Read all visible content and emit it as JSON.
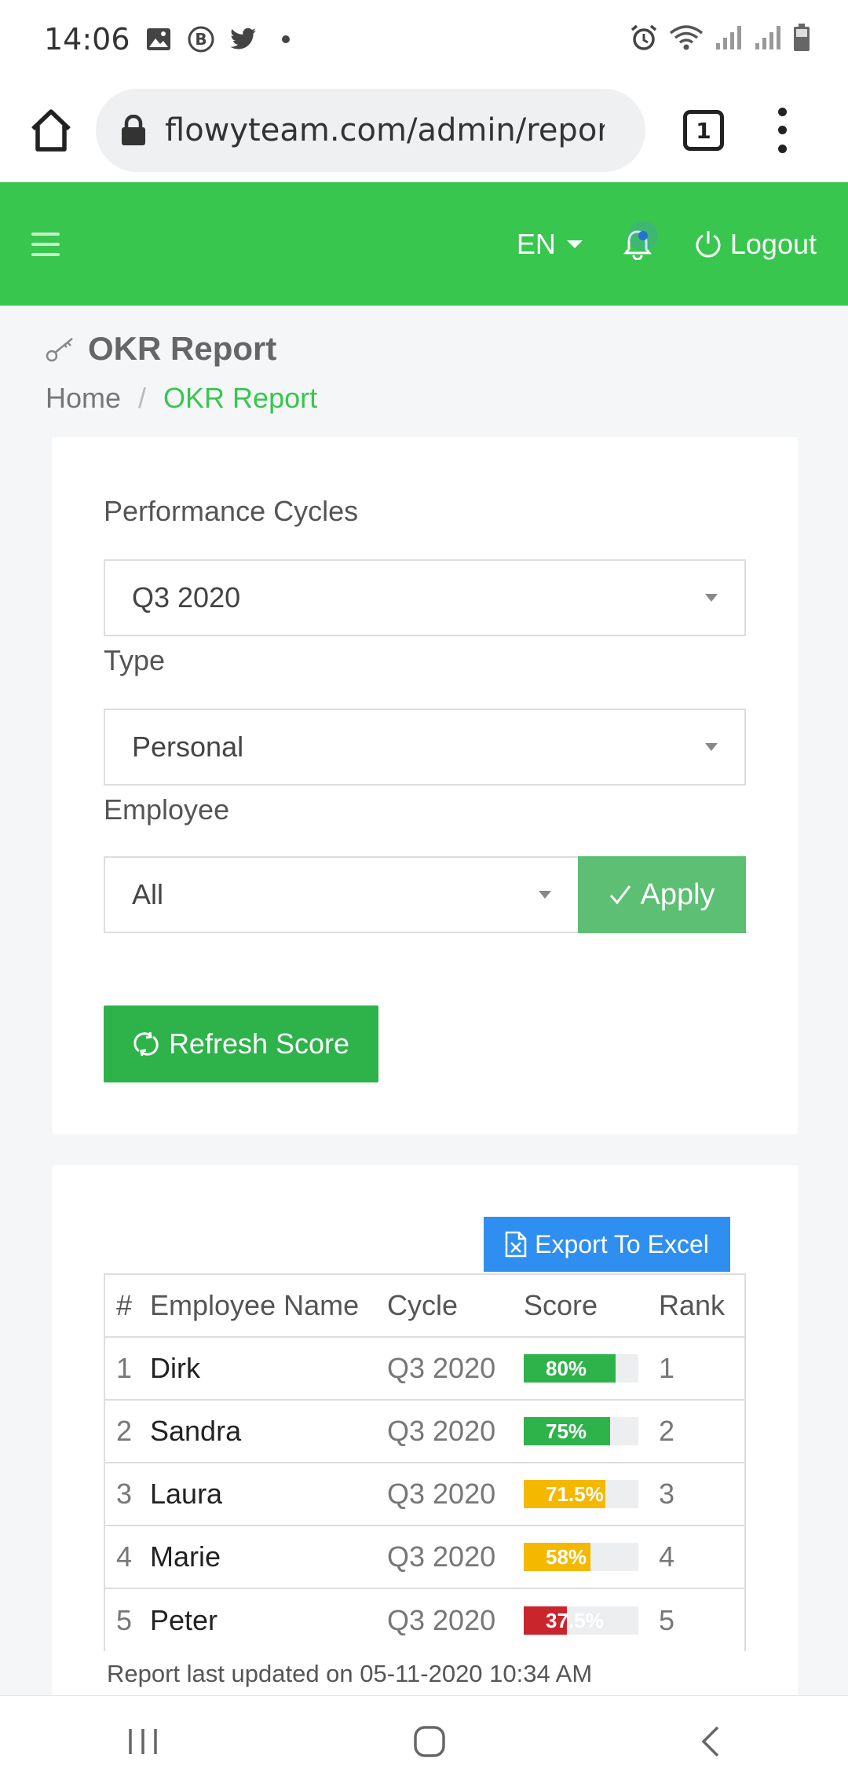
{
  "status_bar": {
    "time": "14:06",
    "icons": [
      "image-icon",
      "b-icon",
      "twitter-icon",
      "dot-icon",
      "alarm-icon",
      "wifi-icon",
      "signal-icon",
      "signal-icon",
      "battery-icon"
    ]
  },
  "browser": {
    "url": "flowyteam.com/admin/report",
    "tab_count": "1"
  },
  "header": {
    "language": "EN",
    "logout_label": "Logout",
    "color": "#38c64f"
  },
  "page": {
    "title": "OKR Report",
    "breadcrumb": {
      "home": "Home",
      "separator": "/",
      "current": "OKR Report"
    }
  },
  "filters": {
    "cycle_label": "Performance Cycles",
    "cycle_value": "Q3 2020",
    "type_label": "Type",
    "type_value": "Personal",
    "employee_label": "Employee",
    "employee_value": "All",
    "apply_label": "Apply",
    "refresh_label": "Refresh Score"
  },
  "report": {
    "export_label": "Export To Excel",
    "columns": [
      "#",
      "Employee Name",
      "Cycle",
      "Score",
      "Rank"
    ],
    "rows": [
      {
        "num": "1",
        "name": "Dirk",
        "cycle": "Q3 2020",
        "score_label": "80%",
        "score": 80,
        "color": "#2eb24a",
        "rank": "1"
      },
      {
        "num": "2",
        "name": "Sandra",
        "cycle": "Q3 2020",
        "score_label": "75%",
        "score": 75,
        "color": "#2eb24a",
        "rank": "2"
      },
      {
        "num": "3",
        "name": "Laura",
        "cycle": "Q3 2020",
        "score_label": "71.5%",
        "score": 71.5,
        "color": "#f5b800",
        "rank": "3"
      },
      {
        "num": "4",
        "name": "Marie",
        "cycle": "Q3 2020",
        "score_label": "58%",
        "score": 58,
        "color": "#f5b800",
        "rank": "4"
      },
      {
        "num": "5",
        "name": "Peter",
        "cycle": "Q3 2020",
        "score_label": "37.5%",
        "score": 37.5,
        "color": "#c9252d",
        "rank": "5"
      }
    ],
    "updated": "Report last updated on 05-11-2020 10:34 AM"
  }
}
